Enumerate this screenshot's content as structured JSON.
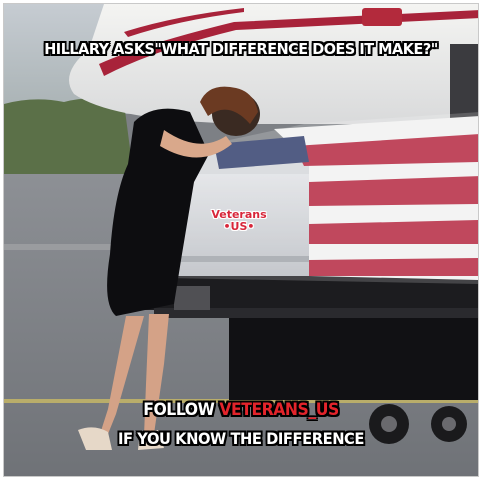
{
  "captions": {
    "top": "HILLARY ASKS\"WHAT DIFFERENCE DOES IT MAKE?\"",
    "follow_prefix": "FOLLOW ",
    "follow_handle": "VETERANS_US",
    "bottom_line2": "IF YOU KNOW THE DIFFERENCE"
  },
  "watermark": {
    "line1": "Veterans",
    "line2": "•US•"
  },
  "colors": {
    "accent": "#e3242b",
    "watermark": "#d8263a",
    "caption": "#ffffff"
  }
}
